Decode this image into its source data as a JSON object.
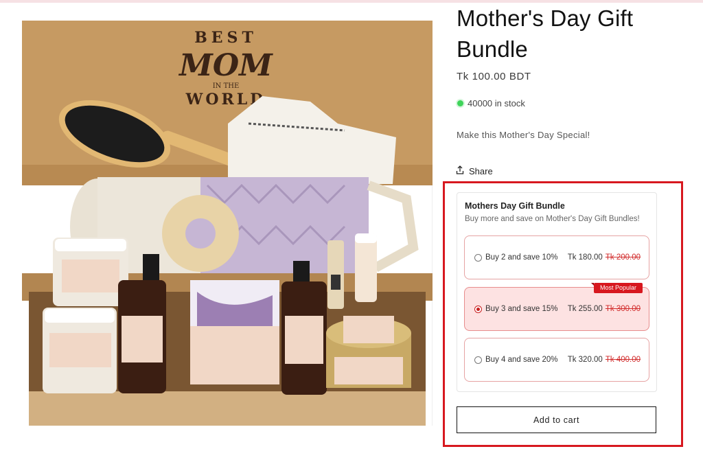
{
  "product": {
    "title": "Mother's Day Gift Bundle",
    "price": "Tk 100.00 BDT",
    "stock_text": "40000 in stock",
    "description": "Make this Mother's Day Special!",
    "share_label": "Share",
    "image_alt": "Gift box with lavender bath products",
    "box_lettering": [
      "BEST",
      "MOM",
      "IN THE",
      "WORLD"
    ]
  },
  "bundle": {
    "title": "Mothers Day Gift Bundle",
    "subtitle": "Buy more and save on Mother's Day Gift Bundles!",
    "options": [
      {
        "label": "Buy 2 and save 10%",
        "price": "Tk 180.00",
        "compare_price": "Tk 200.00",
        "selected": false,
        "badge": ""
      },
      {
        "label": "Buy 3 and save 15%",
        "price": "Tk 255.00",
        "compare_price": "Tk 300.00",
        "selected": true,
        "badge": "Most Popular"
      },
      {
        "label": "Buy 4 and save 20%",
        "price": "Tk 320.00",
        "compare_price": "Tk 400.00",
        "selected": false,
        "badge": ""
      }
    ]
  },
  "cart": {
    "add_label": "Add to cart"
  },
  "icons": {
    "share": "share-icon",
    "stock": "in-stock-dot-icon"
  },
  "colors": {
    "highlight": "#d7181f",
    "option_border": "#e6a3a3",
    "selected_bg": "#fde2e2",
    "stock": "#3fd45a"
  }
}
